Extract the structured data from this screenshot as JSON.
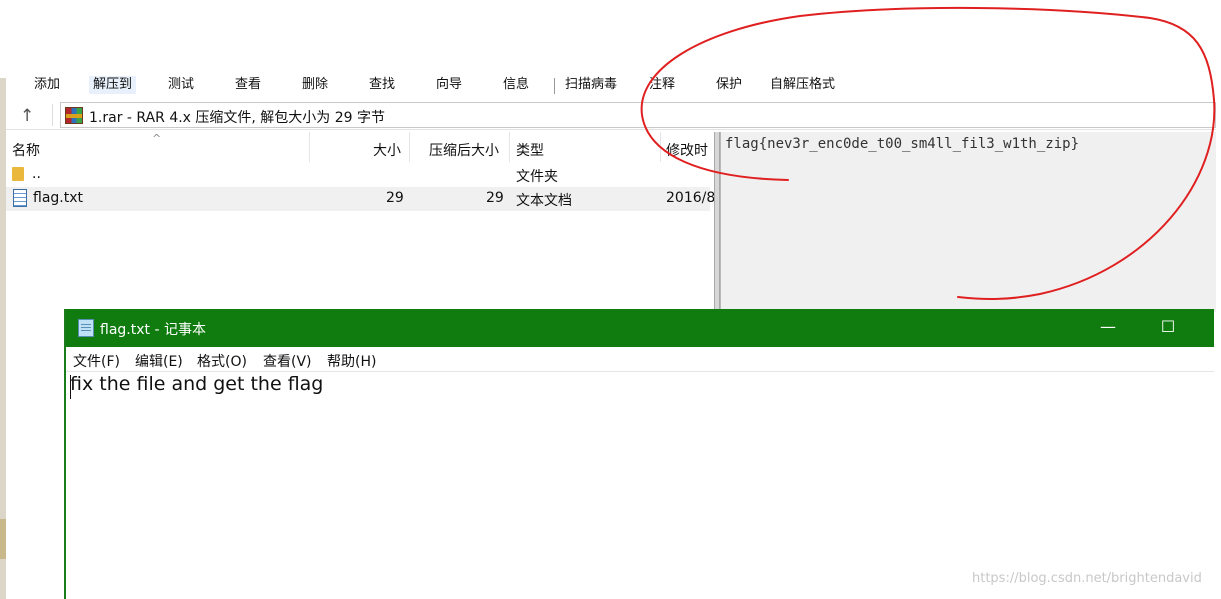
{
  "winrar": {
    "toolbar": [
      {
        "name": "toolbar-add-button",
        "label": "添加"
      },
      {
        "name": "toolbar-extract-to-button",
        "label": "解压到"
      },
      {
        "name": "toolbar-test-button",
        "label": "测试"
      },
      {
        "name": "toolbar-view-button",
        "label": "查看"
      },
      {
        "name": "toolbar-delete-button",
        "label": "删除"
      },
      {
        "name": "toolbar-find-button",
        "label": "查找"
      },
      {
        "name": "toolbar-wizard-button",
        "label": "向导"
      },
      {
        "name": "toolbar-info-button",
        "label": "信息"
      },
      {
        "name": "toolbar-virus-scan-button",
        "label": "扫描病毒"
      },
      {
        "name": "toolbar-comment-button",
        "label": "注释"
      },
      {
        "name": "toolbar-protect-button",
        "label": "保护"
      },
      {
        "name": "toolbar-sfx-button",
        "label": "自解压格式"
      }
    ],
    "address": {
      "path": "1.rar - RAR 4.x 压缩文件, 解包大小为 29 字节"
    },
    "columns": {
      "name": "名称",
      "size": "大小",
      "packed": "压缩后大小",
      "type": "类型",
      "modified": "修改时"
    },
    "rows": [
      {
        "name": "..",
        "size": "",
        "packed": "",
        "type": "文件夹",
        "modified": ""
      },
      {
        "name": "flag.txt",
        "size": "29",
        "packed": "29",
        "type": "文本文档",
        "modified": "2016/8"
      }
    ],
    "preview_text": "flag{nev3r_enc0de_t00_sm4ll_fil3_w1th_zip}"
  },
  "notepad": {
    "title": "flag.txt - 记事本",
    "menu": [
      {
        "name": "menu-file",
        "label": "文件(F)"
      },
      {
        "name": "menu-edit",
        "label": "编辑(E)"
      },
      {
        "name": "menu-format",
        "label": "格式(O)"
      },
      {
        "name": "menu-view",
        "label": "查看(V)"
      },
      {
        "name": "menu-help",
        "label": "帮助(H)"
      }
    ],
    "content": "fix the file and get the flag",
    "minimize_glyph": "—",
    "maximize_glyph": "☐"
  },
  "watermark": "https://blog.csdn.net/brightendavid",
  "colors": {
    "notepad_titlebar": "#107c10",
    "annotation_circle": "#e02020",
    "preview_bg": "#f0f0f0"
  }
}
